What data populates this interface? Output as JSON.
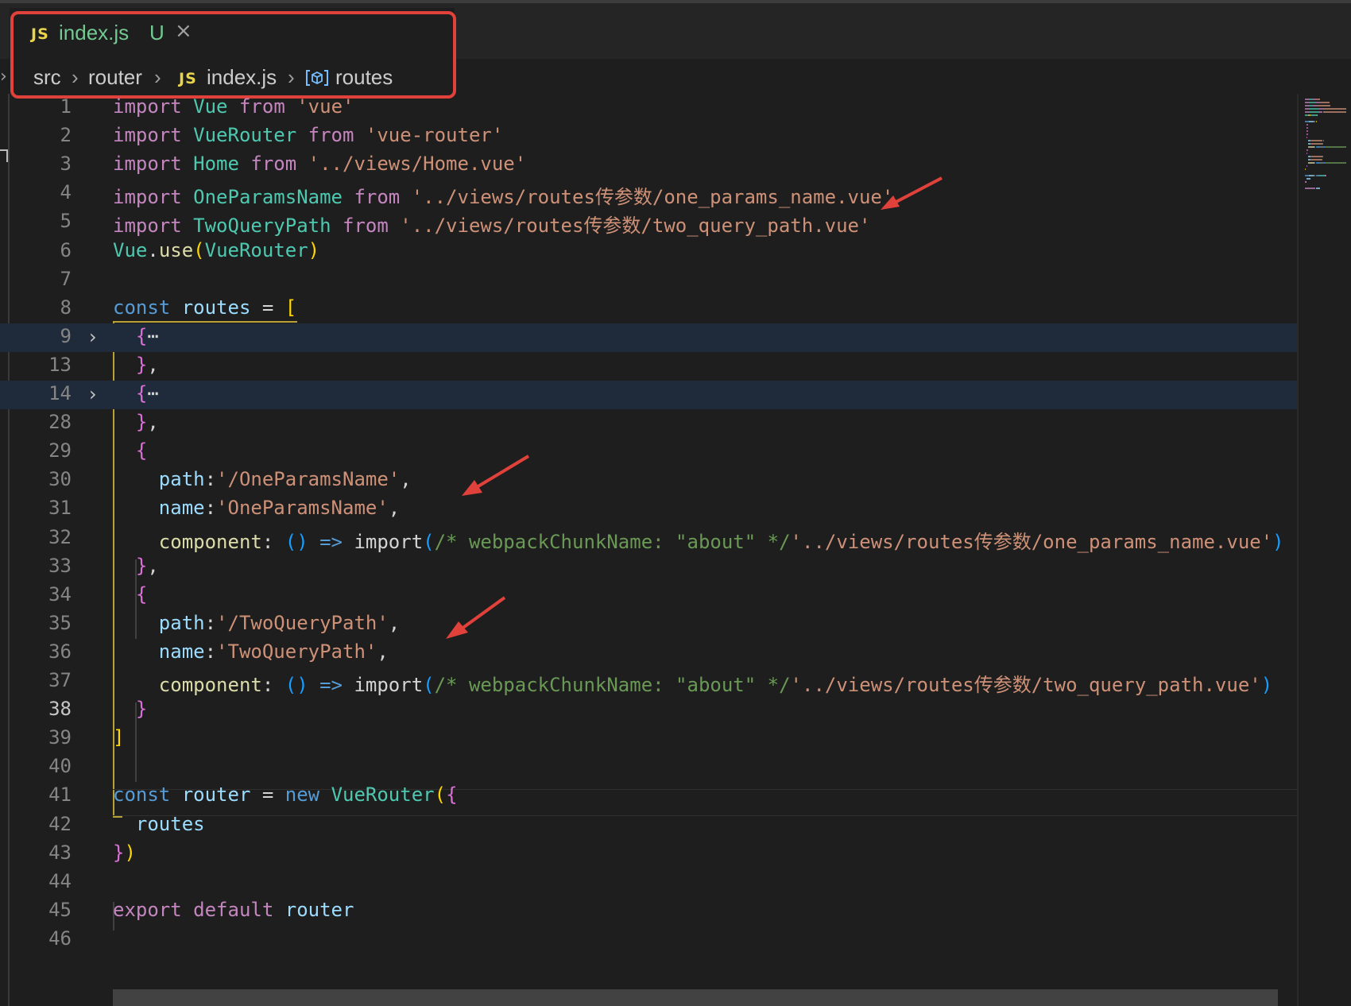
{
  "tab": {
    "icon": "JS",
    "filename": "index.js",
    "status": "U",
    "close_glyph": "×"
  },
  "breadcrumb": {
    "items": [
      "src",
      "router",
      "index.js",
      "routes"
    ],
    "separator": "›",
    "file_icon": "JS",
    "symbol_icon": "symbol-variable-icon"
  },
  "colors": {
    "keyword": "#569cd6",
    "control_keyword": "#c586c0",
    "class": "#4ec9b0",
    "variable": "#9cdcfe",
    "string": "#ce9178",
    "function": "#dcdcaa",
    "comment": "#6a9955",
    "annotation": "#e0413a"
  },
  "editor": {
    "current_line": "38",
    "lines": [
      {
        "n": "1",
        "fold": "",
        "tokens": [
          [
            "kw2",
            "import "
          ],
          [
            "cls",
            "Vue"
          ],
          [
            "kw2",
            " from "
          ],
          [
            "str",
            "'vue'"
          ]
        ]
      },
      {
        "n": "2",
        "fold": "",
        "tokens": [
          [
            "kw2",
            "import "
          ],
          [
            "cls",
            "VueRouter"
          ],
          [
            "kw2",
            " from "
          ],
          [
            "str",
            "'vue-router'"
          ]
        ]
      },
      {
        "n": "3",
        "fold": "",
        "tokens": [
          [
            "kw2",
            "import "
          ],
          [
            "cls",
            "Home"
          ],
          [
            "kw2",
            " from "
          ],
          [
            "str",
            "'../views/Home.vue'"
          ]
        ]
      },
      {
        "n": "4",
        "fold": "",
        "tokens": [
          [
            "kw2",
            "import "
          ],
          [
            "cls",
            "OneParamsName"
          ],
          [
            "kw2",
            " from "
          ],
          [
            "str",
            "'../views/routes传参数/one_params_name.vue'"
          ]
        ]
      },
      {
        "n": "5",
        "fold": "",
        "tokens": [
          [
            "kw2",
            "import "
          ],
          [
            "cls",
            "TwoQueryPath"
          ],
          [
            "kw2",
            " from "
          ],
          [
            "str",
            "'../views/routes传参数/two_query_path.vue'"
          ]
        ]
      },
      {
        "n": "6",
        "fold": "",
        "tokens": [
          [
            "cls",
            "Vue"
          ],
          [
            "plain",
            "."
          ],
          [
            "fn",
            "use"
          ],
          [
            "b1",
            "("
          ],
          [
            "cls",
            "VueRouter"
          ],
          [
            "b1",
            ")"
          ]
        ]
      },
      {
        "n": "7",
        "fold": "",
        "tokens": []
      },
      {
        "n": "8",
        "fold": "",
        "tokens": [
          [
            "kw",
            "const "
          ],
          [
            "var",
            "routes"
          ],
          [
            "plain",
            " = "
          ],
          [
            "b1",
            "["
          ]
        ]
      },
      {
        "n": "9",
        "fold": "›",
        "folded": true,
        "tokens": [
          [
            "plain",
            "  "
          ],
          [
            "b2",
            "{"
          ],
          [
            "plain",
            "⋯"
          ]
        ]
      },
      {
        "n": "13",
        "fold": "",
        "tokens": [
          [
            "plain",
            "  "
          ],
          [
            "b2",
            "}"
          ],
          [
            "plain",
            ","
          ]
        ]
      },
      {
        "n": "14",
        "fold": "›",
        "folded": true,
        "tokens": [
          [
            "plain",
            "  "
          ],
          [
            "b2",
            "{"
          ],
          [
            "plain",
            "⋯"
          ]
        ]
      },
      {
        "n": "28",
        "fold": "",
        "tokens": [
          [
            "plain",
            "  "
          ],
          [
            "b2",
            "}"
          ],
          [
            "plain",
            ","
          ]
        ]
      },
      {
        "n": "29",
        "fold": "",
        "tokens": [
          [
            "plain",
            "  "
          ],
          [
            "b2",
            "{"
          ]
        ]
      },
      {
        "n": "30",
        "fold": "",
        "tokens": [
          [
            "plain",
            "    "
          ],
          [
            "var",
            "path"
          ],
          [
            "plain",
            ":"
          ],
          [
            "str",
            "'/OneParamsName'"
          ],
          [
            "plain",
            ","
          ]
        ]
      },
      {
        "n": "31",
        "fold": "",
        "tokens": [
          [
            "plain",
            "    "
          ],
          [
            "var",
            "name"
          ],
          [
            "plain",
            ":"
          ],
          [
            "str",
            "'OneParamsName'"
          ],
          [
            "plain",
            ","
          ]
        ]
      },
      {
        "n": "32",
        "fold": "",
        "tokens": [
          [
            "plain",
            "    "
          ],
          [
            "fn",
            "component"
          ],
          [
            "plain",
            ": "
          ],
          [
            "b3",
            "()"
          ],
          [
            "kw",
            " => "
          ],
          [
            "plain",
            "import"
          ],
          [
            "b3",
            "("
          ],
          [
            "cmt",
            "/* webpackChunkName: \"about\" */"
          ],
          [
            "str",
            "'../views/routes传参数/one_params_name.vue'"
          ],
          [
            "b3",
            ")"
          ]
        ]
      },
      {
        "n": "33",
        "fold": "",
        "tokens": [
          [
            "plain",
            "  "
          ],
          [
            "b2",
            "}"
          ],
          [
            "plain",
            ","
          ]
        ]
      },
      {
        "n": "34",
        "fold": "",
        "tokens": [
          [
            "plain",
            "  "
          ],
          [
            "b2",
            "{"
          ]
        ]
      },
      {
        "n": "35",
        "fold": "",
        "tokens": [
          [
            "plain",
            "    "
          ],
          [
            "var",
            "path"
          ],
          [
            "plain",
            ":"
          ],
          [
            "str",
            "'/TwoQueryPath'"
          ],
          [
            "plain",
            ","
          ]
        ]
      },
      {
        "n": "36",
        "fold": "",
        "tokens": [
          [
            "plain",
            "    "
          ],
          [
            "var",
            "name"
          ],
          [
            "plain",
            ":"
          ],
          [
            "str",
            "'TwoQueryPath'"
          ],
          [
            "plain",
            ","
          ]
        ]
      },
      {
        "n": "37",
        "fold": "",
        "tokens": [
          [
            "plain",
            "    "
          ],
          [
            "fn",
            "component"
          ],
          [
            "plain",
            ": "
          ],
          [
            "b3",
            "()"
          ],
          [
            "kw",
            " => "
          ],
          [
            "plain",
            "import"
          ],
          [
            "b3",
            "("
          ],
          [
            "cmt",
            "/* webpackChunkName: \"about\" */"
          ],
          [
            "str",
            "'../views/routes传参数/two_query_path.vue'"
          ],
          [
            "b3",
            ")"
          ]
        ]
      },
      {
        "n": "38",
        "fold": "",
        "tokens": [
          [
            "plain",
            "  "
          ],
          [
            "b2",
            "}"
          ]
        ]
      },
      {
        "n": "39",
        "fold": "",
        "tokens": [
          [
            "b1",
            "]"
          ]
        ]
      },
      {
        "n": "40",
        "fold": "",
        "tokens": []
      },
      {
        "n": "41",
        "fold": "",
        "tokens": [
          [
            "kw",
            "const "
          ],
          [
            "var",
            "router"
          ],
          [
            "plain",
            " = "
          ],
          [
            "kw",
            "new "
          ],
          [
            "cls",
            "VueRouter"
          ],
          [
            "b1",
            "("
          ],
          [
            "b2",
            "{"
          ]
        ]
      },
      {
        "n": "42",
        "fold": "",
        "tokens": [
          [
            "plain",
            "  "
          ],
          [
            "var",
            "routes"
          ]
        ]
      },
      {
        "n": "43",
        "fold": "",
        "tokens": [
          [
            "b2",
            "}"
          ],
          [
            "b1",
            ")"
          ]
        ]
      },
      {
        "n": "44",
        "fold": "",
        "tokens": []
      },
      {
        "n": "45",
        "fold": "",
        "tokens": [
          [
            "kw2",
            "export "
          ],
          [
            "kw2",
            "default "
          ],
          [
            "var",
            "router"
          ]
        ]
      },
      {
        "n": "46",
        "fold": "",
        "tokens": []
      }
    ]
  },
  "annotations": {
    "highlight_box": "red-highlight-box",
    "arrows": [
      "arrow-line-4",
      "arrow-line-30",
      "arrow-line-35"
    ]
  }
}
